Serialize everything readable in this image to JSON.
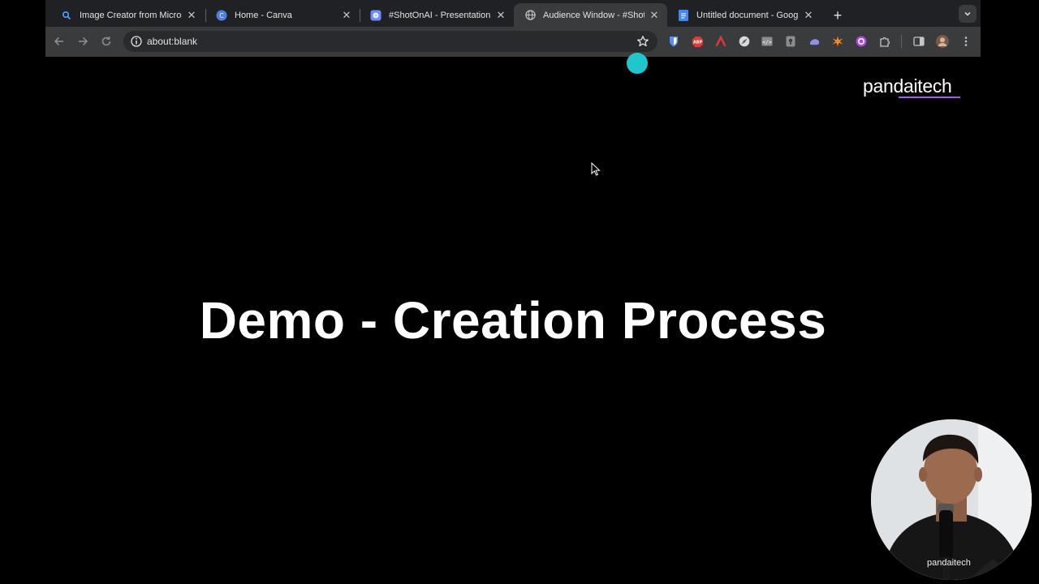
{
  "browser": {
    "tabs": [
      {
        "title": "Image Creator from Microsoft",
        "icon": "bing-search-icon",
        "active": false
      },
      {
        "title": "Home - Canva",
        "icon": "canva-icon",
        "active": false
      },
      {
        "title": "#ShotOnAI - Presentation",
        "icon": "presentation-icon",
        "active": false
      },
      {
        "title": "Audience Window - #ShotOnAI",
        "icon": "globe-icon",
        "active": true
      },
      {
        "title": "Untitled document - Google Docs",
        "icon": "google-docs-icon",
        "active": false
      }
    ],
    "address_bar": {
      "url": "about:blank"
    },
    "extensions": [
      "bitwarden-icon",
      "adblock-icon",
      "pdf-icon",
      "compass-icon",
      "code-icon",
      "shield-icon",
      "cloud-icon",
      "spark-icon",
      "circle-icon",
      "puzzle-icon"
    ]
  },
  "slide": {
    "brand": "pandaitech",
    "headline": "Demo - Creation Process"
  },
  "webcam": {
    "shirt_text": "pandaitech"
  },
  "colors": {
    "accent_dot": "#1fc6cc",
    "brand_underline": "#a45cf0",
    "toolbar": "#3a3b3d",
    "tabstrip": "#202124"
  }
}
